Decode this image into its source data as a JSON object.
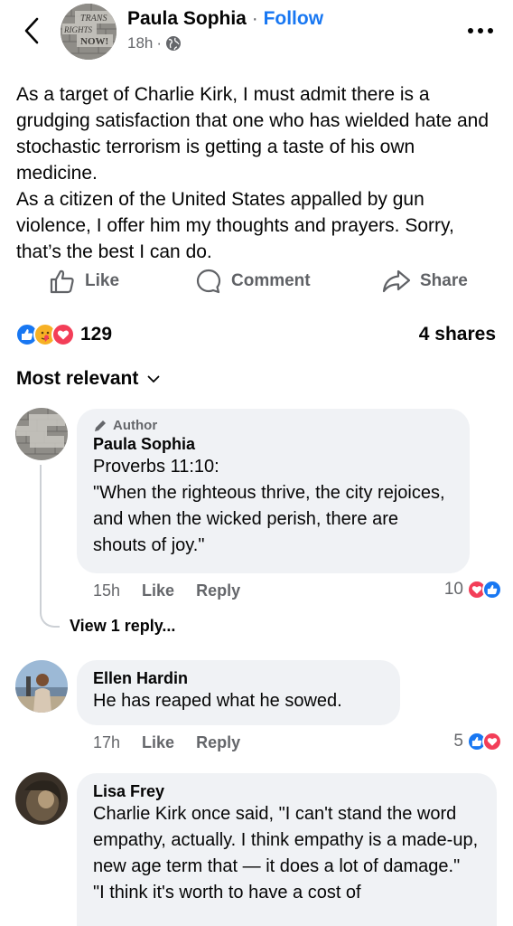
{
  "header": {
    "author": "Paula Sophia",
    "separator": "·",
    "follow": "Follow",
    "time": "18h",
    "meta_dot": "·",
    "avatar_text": [
      "TRANS",
      "RIGHTS",
      "NOW!"
    ]
  },
  "post": {
    "text": "As a target of Charlie Kirk, I must admit there is a grudging satisfaction that one who has wielded hate and stochastic terrorism is getting a taste of his own medicine.\nAs a citizen of the United States appalled by gun violence, I offer him my thoughts and prayers. Sorry, that’s the best I can do."
  },
  "actions": {
    "like": "Like",
    "comment": "Comment",
    "share": "Share"
  },
  "stats": {
    "reactions": "129",
    "shares": "4 shares"
  },
  "sort": {
    "label": "Most relevant"
  },
  "comments": [
    {
      "badge": "Author",
      "name": "Paula Sophia",
      "text": "Proverbs 11:10:\n\"When the righteous thrive, the city rejoices, and when the wicked perish, there are shouts of joy.\"",
      "time": "15h",
      "like": "Like",
      "reply": "Reply",
      "reactions": "10",
      "view_replies": "View 1 reply..."
    },
    {
      "name": "Ellen Hardin",
      "text": "He has reaped what he sowed.",
      "time": "17h",
      "like": "Like",
      "reply": "Reply",
      "reactions": "5"
    },
    {
      "name": "Lisa Frey",
      "text": "Charlie Kirk once said, \"I can't stand the word empathy, actually. I think empathy is a made-up, new age term that — it does a lot of damage.\"\n\"I think it's worth to have a cost of"
    }
  ],
  "colors": {
    "like_blue": "#1877f2",
    "love_red": "#f33e58",
    "care_yellow": "#f7b125",
    "bubble_bg": "#f0f2f5",
    "muted": "#65676b"
  }
}
